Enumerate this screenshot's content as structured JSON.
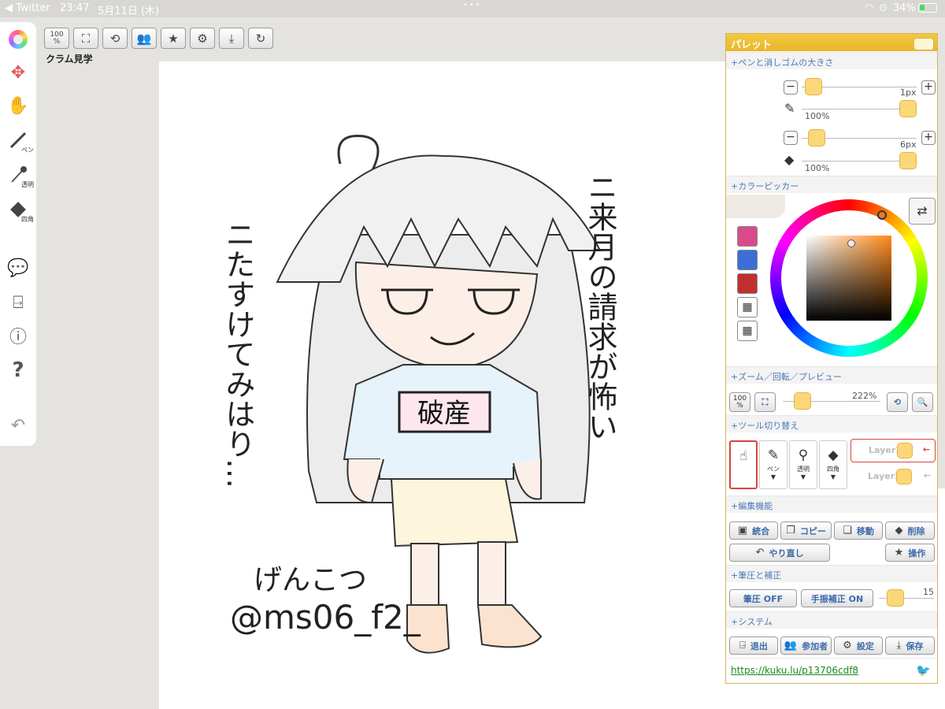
{
  "status_bar": {
    "back_app": "◀ Twitter",
    "time": "23:47",
    "date": "5月11日 (木)",
    "battery": "34%"
  },
  "left_toolbar": {
    "pen": "ペン",
    "transparent": "透明",
    "rect": "四角"
  },
  "top_toolbar": {
    "zoom": "100",
    "zoom_unit": "%"
  },
  "room_name": "クラム見学",
  "palette": {
    "title": "パレット",
    "pen_eraser_size": "+ペンと消しゴムの大きさ",
    "pen_size": "1px",
    "pen_opacity": "100%",
    "eraser_size": "6px",
    "eraser_opacity": "100%",
    "color_picker": "+カラーピッカー",
    "zoom_section": "+ズーム／回転／プレビュー",
    "zoom_value": "222%",
    "zoom_100": "100",
    "zoom_unit": "%",
    "tool_switch": "+ツール切り替え",
    "tool_pen": "ペン",
    "tool_transparent": "透明",
    "tool_rect": "四角",
    "layer1": "Layer1",
    "layer2": "Layer2",
    "edit_section": "+編集機能",
    "merge": "統合",
    "copy": "コピー",
    "move": "移動",
    "delete": "削除",
    "redo": "やり直し",
    "operation": "操作",
    "pressure_section": "+筆圧と補正",
    "pressure": "筆圧 OFF",
    "stabilizer": "手振補正 ON",
    "stabilizer_value": "15",
    "system_section": "+システム",
    "exit": "退出",
    "participants": "参加者",
    "settings": "設定",
    "save": "保存",
    "url": "https://kuku.lu/p13706cdf8"
  },
  "colors": {
    "swatch1": "#d94a8c",
    "swatch2": "#3b6fd6",
    "swatch3": "#c0302e"
  },
  "drawing": {
    "left_text": "ニたすけてみはり…",
    "right_text": "ニ来月の請求が怖い",
    "shirt_text": "破産",
    "signature": "げんこつ",
    "handle": "@ms06_f2_"
  }
}
